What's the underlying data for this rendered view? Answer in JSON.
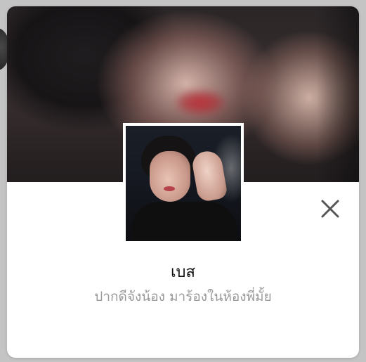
{
  "profile": {
    "name": "เบส",
    "status_message": "ปากดีจังน้อง มาร้องในห้องพี่มั้ย"
  },
  "icons": {
    "close": "close-icon"
  },
  "colors": {
    "card_background": "#ffffff",
    "name_text": "#111111",
    "status_text": "#9a9a9a",
    "close_icon": "#555555",
    "photo_border": "#ffffff"
  }
}
